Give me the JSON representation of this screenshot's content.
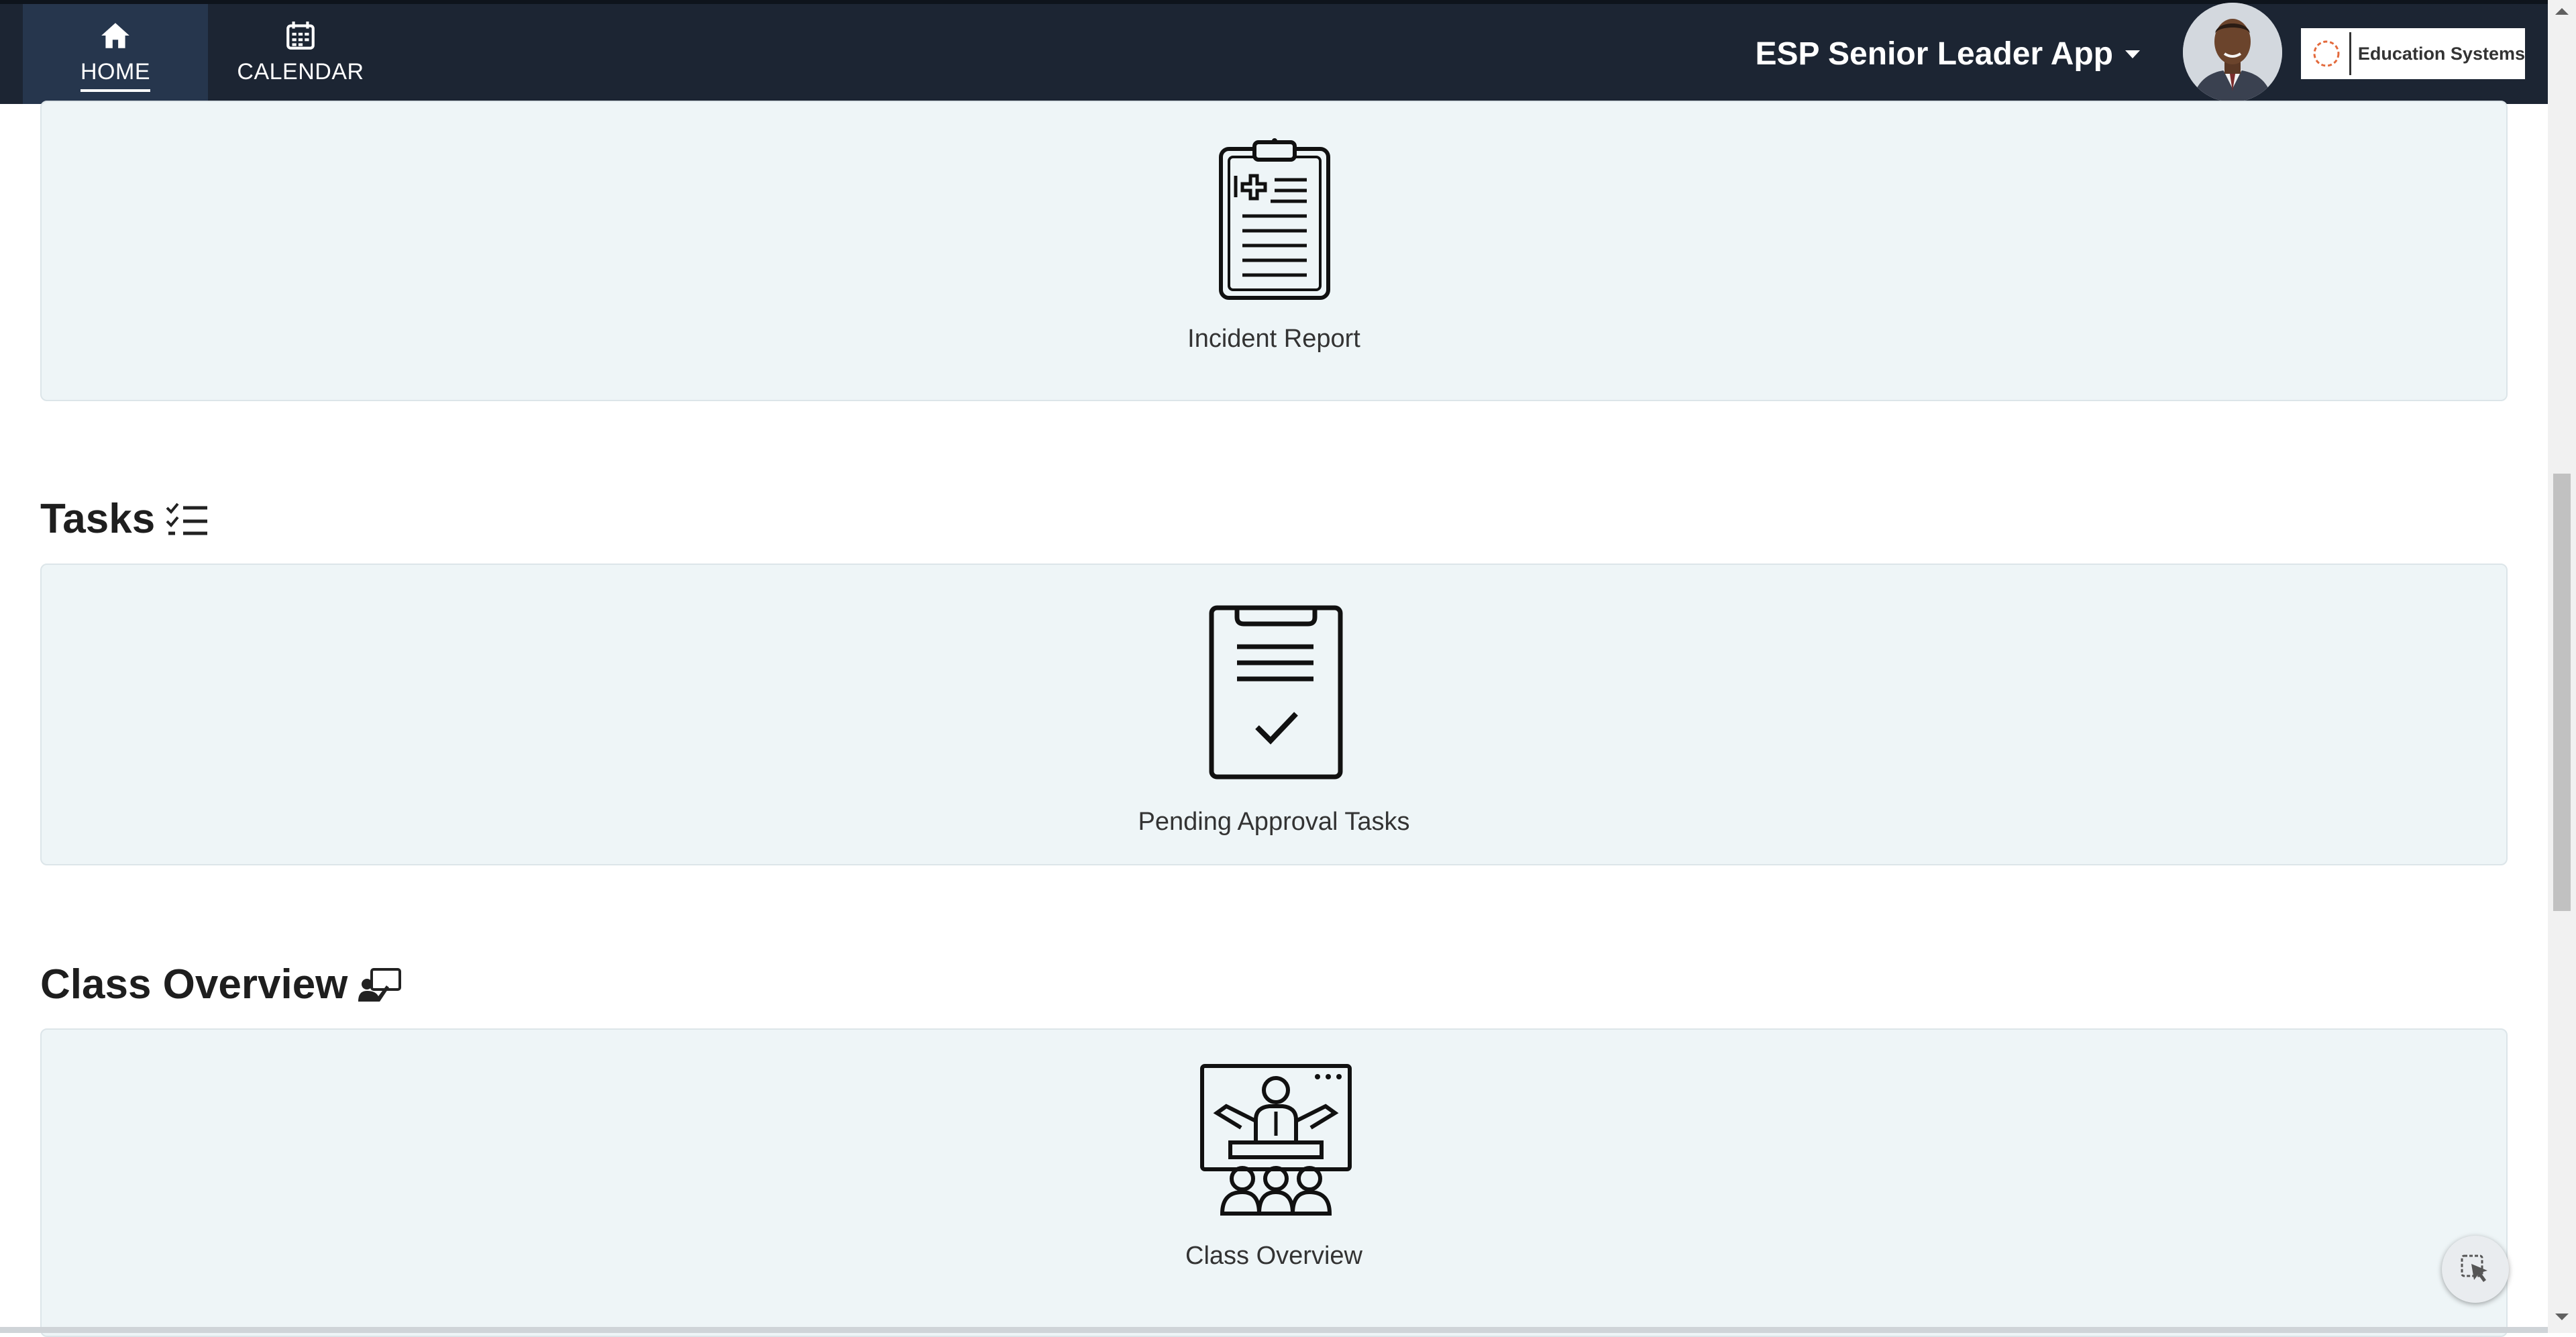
{
  "nav": {
    "home_label": "HOME",
    "calendar_label": "CALENDAR",
    "home_icon": "home-icon",
    "calendar_icon": "calendar-icon"
  },
  "header": {
    "app_title": "ESP Senior Leader App",
    "logo_text": "Education Systems"
  },
  "cards": {
    "incident_report": {
      "label": "Incident Report",
      "icon": "clipboard-medical-icon"
    },
    "pending_approval": {
      "label": "Pending Approval Tasks",
      "icon": "clipboard-check-icon"
    },
    "class_overview": {
      "label": "Class Overview",
      "icon": "classroom-teacher-icon"
    }
  },
  "sections": {
    "tasks": {
      "title": "Tasks",
      "icon": "task-list-icon"
    },
    "class_overview": {
      "title": "Class Overview",
      "icon": "presenter-icon"
    }
  },
  "colors": {
    "topbar": "#1c2533",
    "nav_active": "#26364d",
    "card_bg": "#eef5f7",
    "card_border": "#dce5e9"
  }
}
